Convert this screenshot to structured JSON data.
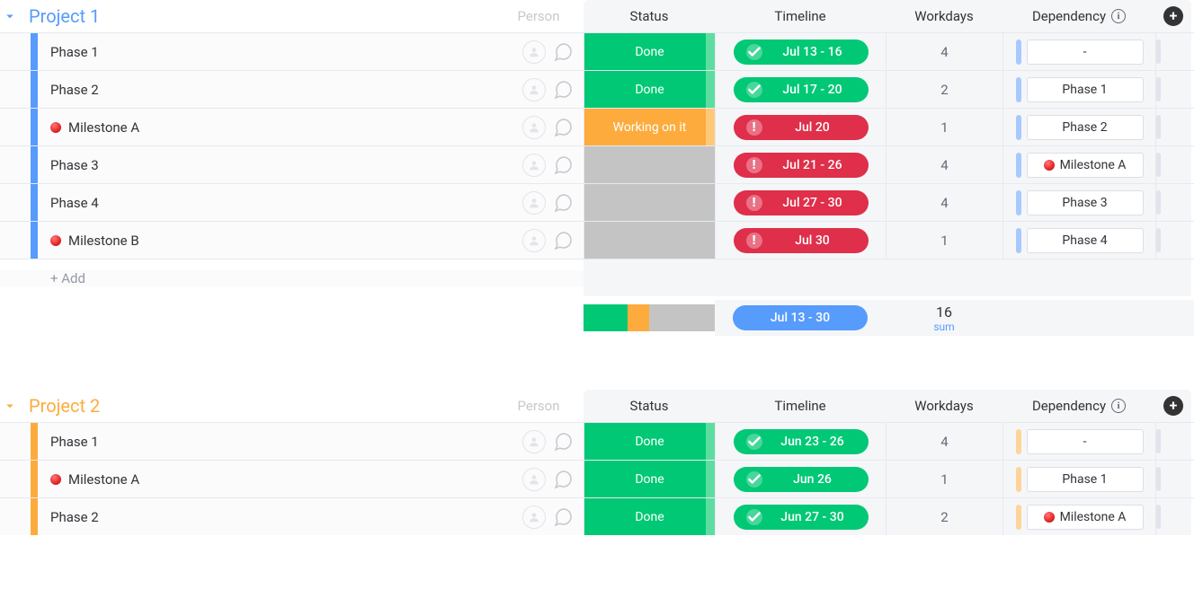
{
  "columns": {
    "person": "Person",
    "status": "Status",
    "timeline": "Timeline",
    "workdays": "Workdays",
    "dependency": "Dependency"
  },
  "add_row_label": "+ Add",
  "status_labels": {
    "done": "Done",
    "working": "Working on it",
    "empty": ""
  },
  "groups": [
    {
      "id": "g1",
      "title": "Project 1",
      "accent": "blue",
      "rows": [
        {
          "name": "Phase 1",
          "milestone": false,
          "status": "done",
          "timeline": "Jul 13 - 16",
          "tl_state": "done",
          "workdays": "4",
          "dependency": "-",
          "dep_milestone": false
        },
        {
          "name": "Phase 2",
          "milestone": false,
          "status": "done",
          "timeline": "Jul 17 - 20",
          "tl_state": "done",
          "workdays": "2",
          "dependency": "Phase 1",
          "dep_milestone": false
        },
        {
          "name": "Milestone A",
          "milestone": true,
          "status": "working",
          "timeline": "Jul 20",
          "tl_state": "overdue",
          "workdays": "1",
          "dependency": "Phase 2",
          "dep_milestone": false
        },
        {
          "name": "Phase 3",
          "milestone": false,
          "status": "empty",
          "timeline": "Jul 21 - 26",
          "tl_state": "overdue",
          "workdays": "4",
          "dependency": "Milestone A",
          "dep_milestone": true
        },
        {
          "name": "Phase 4",
          "milestone": false,
          "status": "empty",
          "timeline": "Jul 27 - 30",
          "tl_state": "overdue",
          "workdays": "4",
          "dependency": "Phase 3",
          "dep_milestone": false
        },
        {
          "name": "Milestone B",
          "milestone": true,
          "status": "empty",
          "timeline": "Jul 30",
          "tl_state": "overdue",
          "workdays": "1",
          "dependency": "Phase 4",
          "dep_milestone": false
        }
      ],
      "summary": {
        "status_breakdown": [
          {
            "color": "#00C875",
            "pct": 33.3
          },
          {
            "color": "#FDAB3D",
            "pct": 16.7
          },
          {
            "color": "#c4c4c4",
            "pct": 50.0
          }
        ],
        "timeline": "Jul 13 - 30",
        "workdays_total": "16",
        "workdays_label": "sum"
      }
    },
    {
      "id": "g2",
      "title": "Project 2",
      "accent": "orange",
      "rows": [
        {
          "name": "Phase 1",
          "milestone": false,
          "status": "done",
          "timeline": "Jun 23 - 26",
          "tl_state": "done",
          "workdays": "4",
          "dependency": "-",
          "dep_milestone": false
        },
        {
          "name": "Milestone A",
          "milestone": true,
          "status": "done",
          "timeline": "Jun 26",
          "tl_state": "done",
          "workdays": "1",
          "dependency": "Phase 1",
          "dep_milestone": false
        },
        {
          "name": "Phase 2",
          "milestone": false,
          "status": "done",
          "timeline": "Jun 27 - 30",
          "tl_state": "done",
          "workdays": "2",
          "dependency": "Milestone A",
          "dep_milestone": true
        }
      ]
    }
  ]
}
